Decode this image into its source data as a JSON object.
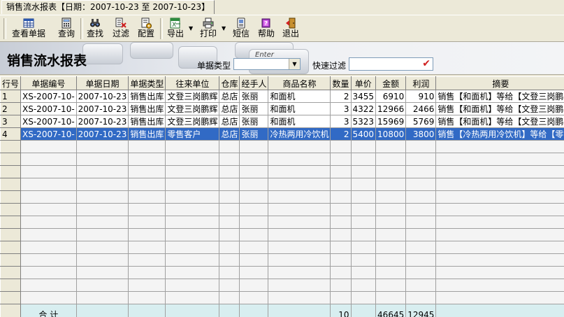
{
  "tab": {
    "title": "销售流水报表【日期：2007-10-23 至 2007-10-23】"
  },
  "toolbar": {
    "items": [
      {
        "label": "查看单据",
        "icon": "table-icon"
      },
      {
        "label": "查询",
        "icon": "calculator-icon"
      },
      {
        "label": "查找",
        "icon": "binoculars-icon"
      },
      {
        "label": "过滤",
        "icon": "filter-icon"
      },
      {
        "label": "配置",
        "icon": "config-icon"
      },
      {
        "label": "导出",
        "icon": "excel-export-icon"
      },
      {
        "label": "打印",
        "icon": "printer-icon"
      },
      {
        "label": "短信",
        "icon": "sms-icon"
      },
      {
        "label": "帮助",
        "icon": "help-book-icon"
      },
      {
        "label": "退出",
        "icon": "exit-door-icon"
      }
    ]
  },
  "banner": {
    "title": "销售流水报表",
    "key_text": "Enter"
  },
  "filters": {
    "doc_type_label": "单据类型",
    "doc_type_value": "",
    "quick_filter_label": "快速过滤",
    "quick_filter_value": ""
  },
  "table": {
    "headers": [
      "行号",
      "单据编号",
      "单据日期",
      "单据类型",
      "往来单位",
      "仓库",
      "经手人",
      "商品名称",
      "数量",
      "单价",
      "金额",
      "利润",
      "摘要"
    ],
    "rows": [
      [
        "1",
        "XS-2007-10-",
        "2007-10-23",
        "销售出库",
        "文登三岗鹏辉",
        "总店",
        "张丽",
        "和面机",
        "2",
        "3455",
        "6910",
        "910",
        "销售【和面机】等给【文登三岗鹏"
      ],
      [
        "2",
        "XS-2007-10-",
        "2007-10-23",
        "销售出库",
        "文登三岗鹏辉",
        "总店",
        "张丽",
        "和面机",
        "3",
        "4322",
        "12966",
        "2466",
        "销售【和面机】等给【文登三岗鹏"
      ],
      [
        "3",
        "XS-2007-10-",
        "2007-10-23",
        "销售出库",
        "文登三岗鹏辉",
        "总店",
        "张丽",
        "和面机",
        "3",
        "5323",
        "15969",
        "5769",
        "销售【和面机】等给【文登三岗鹏"
      ],
      [
        "4",
        "XS-2007-10-",
        "2007-10-23",
        "销售出库",
        "零售客户",
        "总店",
        "张丽",
        "冷热两用冷饮机",
        "2",
        "5400",
        "10800",
        "3800",
        "销售【冷热两用冷饮机】等给【零"
      ]
    ],
    "selected_row": 3,
    "total": {
      "label": "合 计",
      "quantity": "10",
      "amount": "46645",
      "profit": "12945"
    }
  },
  "colors": {
    "selection": "#316ac5",
    "total_row": "#d8eef0",
    "chrome": "#ece9d8"
  }
}
